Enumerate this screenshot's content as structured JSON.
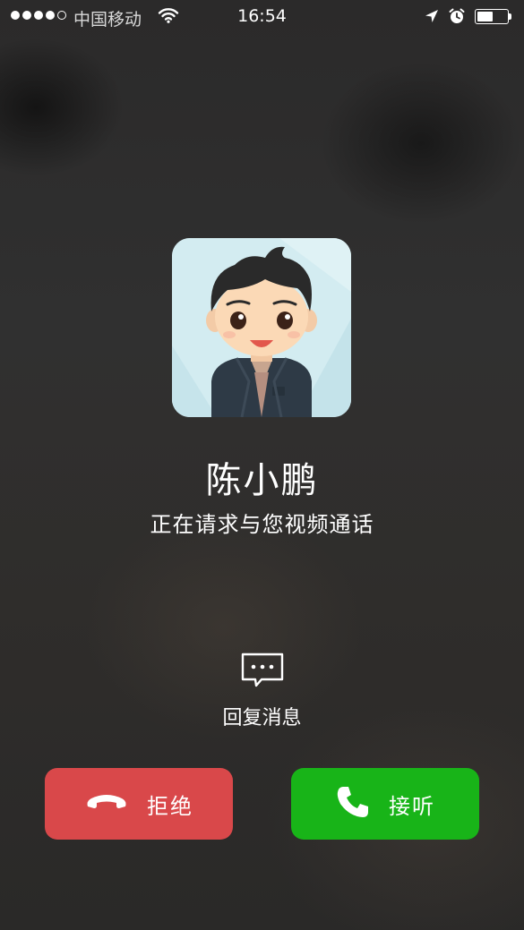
{
  "status_bar": {
    "carrier": "中国移动",
    "time": "16:54",
    "signal_filled": 4,
    "signal_total": 5,
    "battery_level": 0.55,
    "icons": [
      "wifi-icon",
      "location-arrow-icon",
      "alarm-clock-icon",
      "battery-icon"
    ]
  },
  "caller": {
    "name": "陈小鹏",
    "status": "正在请求与您视频通话",
    "avatar_icon": "cartoon-avatar"
  },
  "reply": {
    "label": "回复消息",
    "icon": "message-bubble-icon"
  },
  "actions": {
    "decline_label": "拒绝",
    "decline_icon": "hang-up-phone-icon",
    "decline_color": "#d9484a",
    "accept_label": "接听",
    "accept_icon": "phone-icon",
    "accept_color": "#18b418"
  }
}
